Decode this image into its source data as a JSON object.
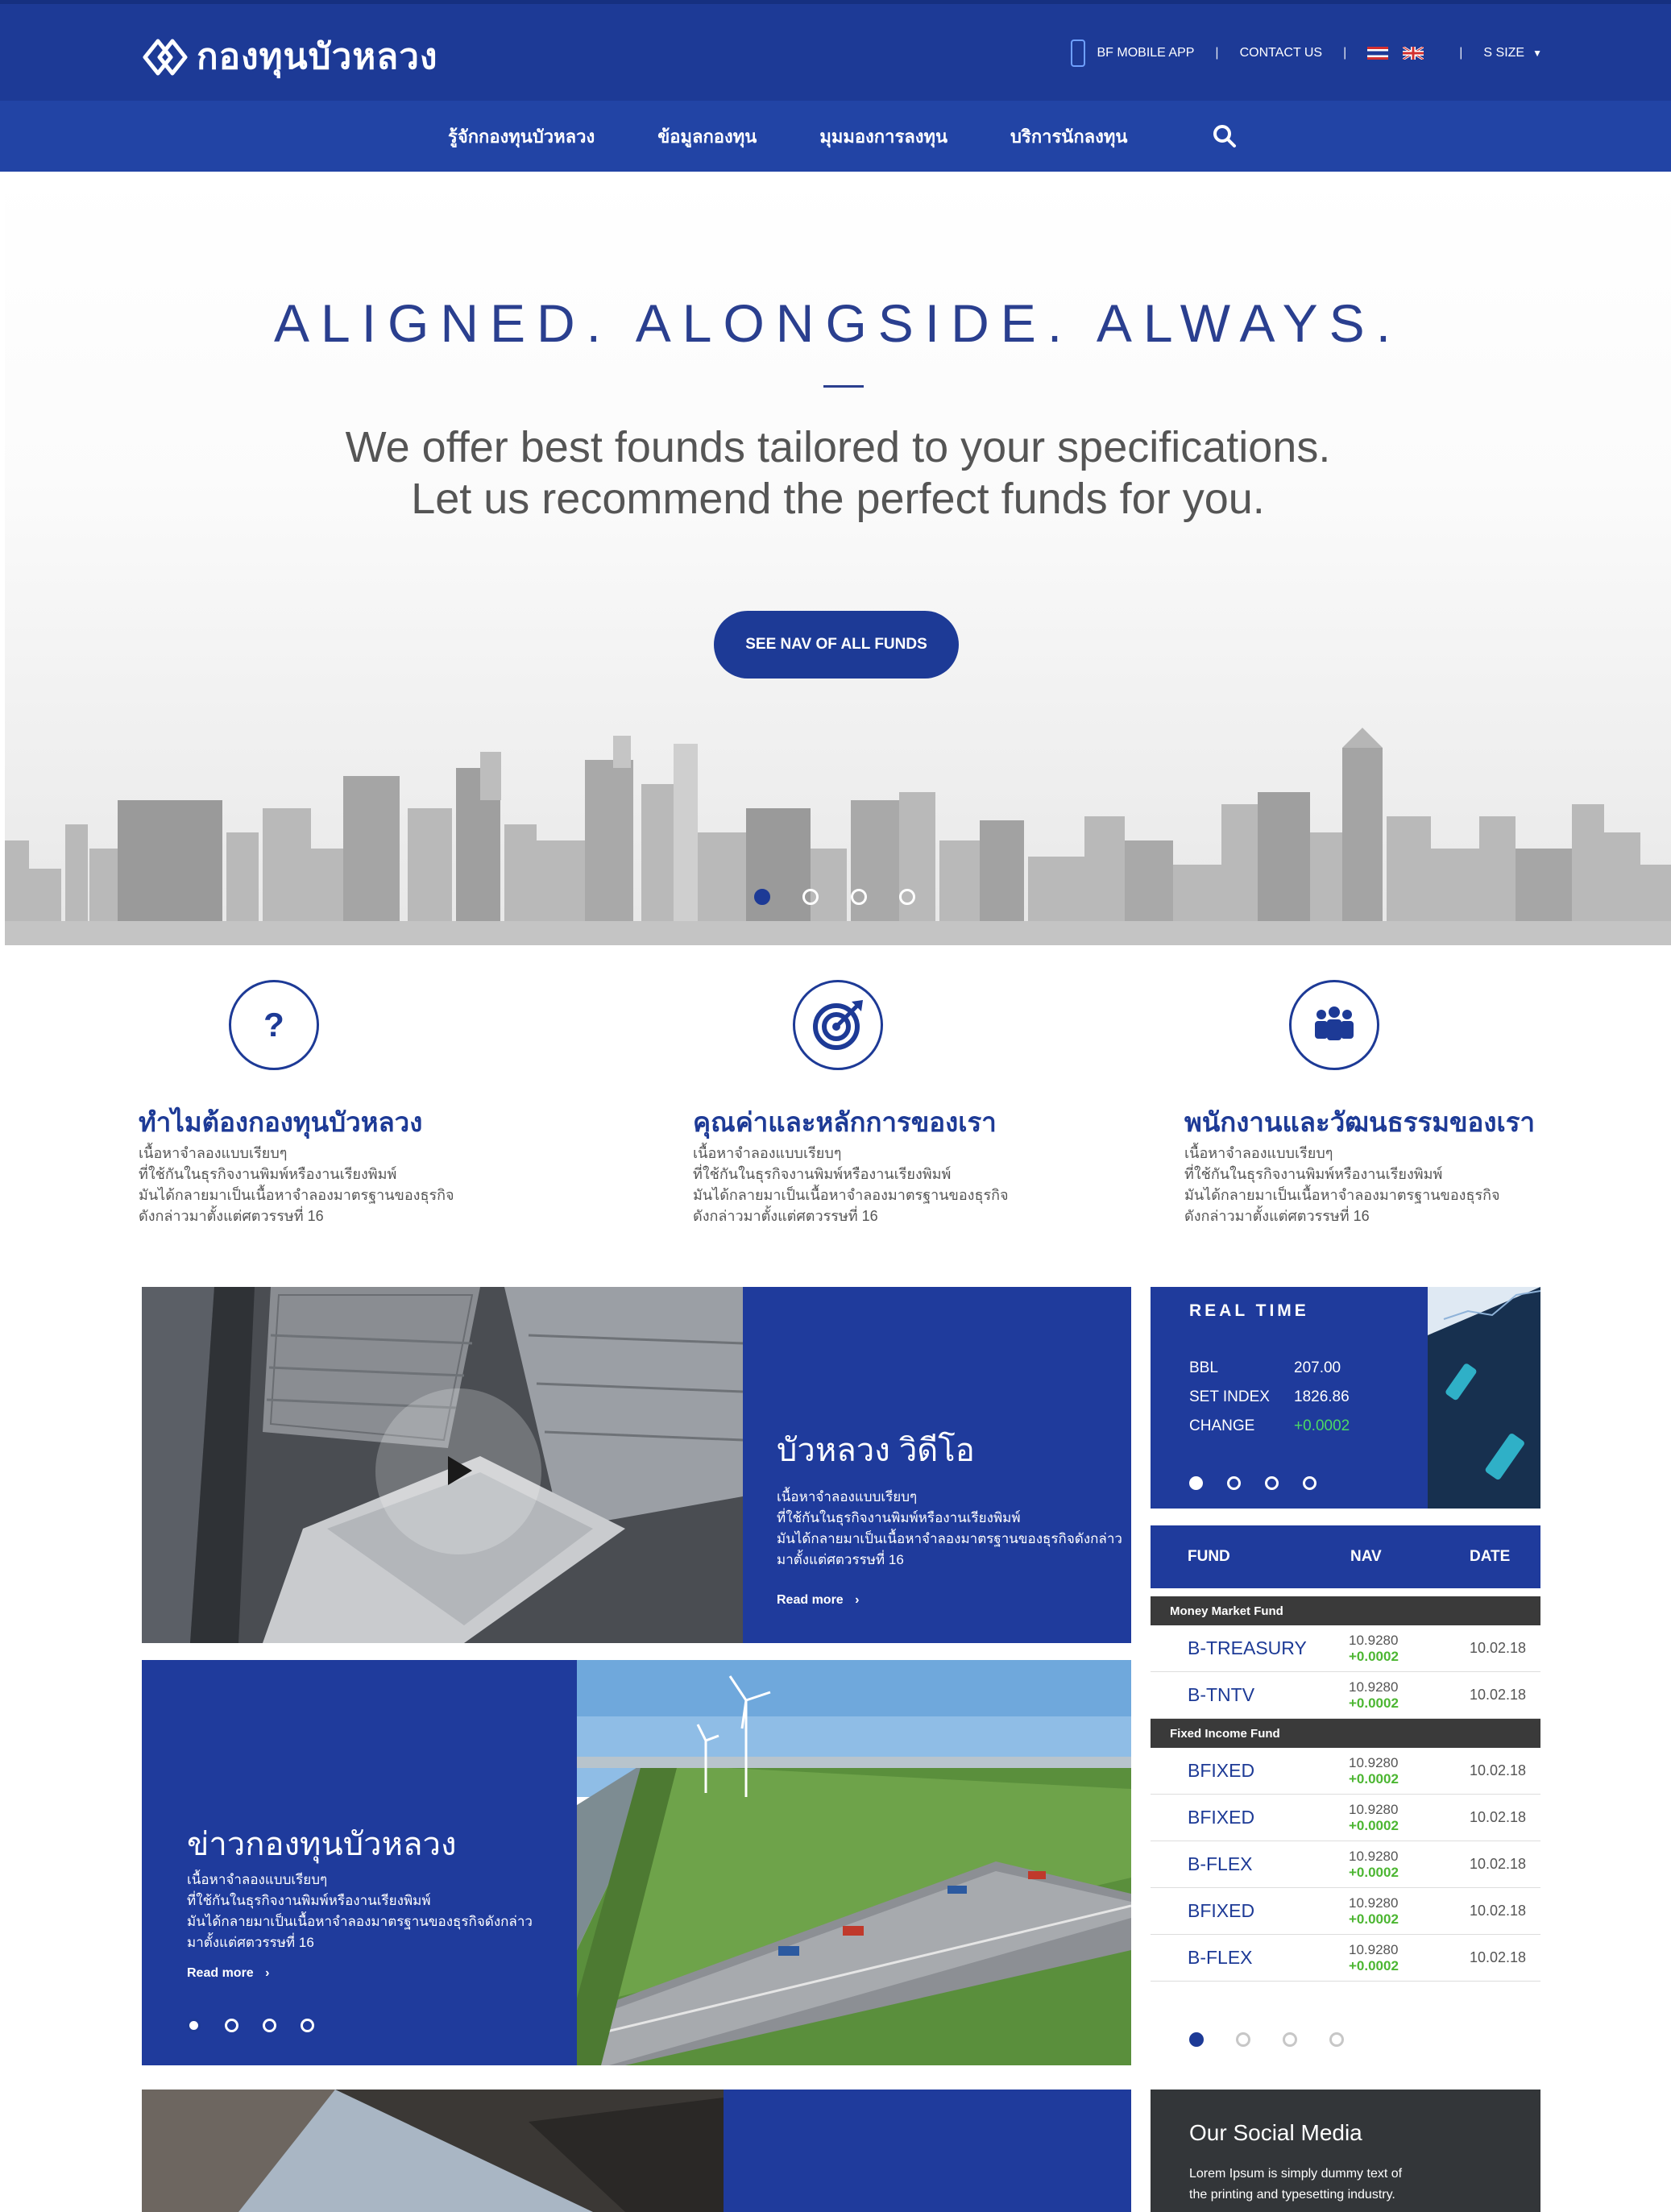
{
  "header": {
    "logo_text": "กองทุนบัวหลวง",
    "mobile_app": "BF MOBILE APP",
    "contact": "CONTACT US",
    "size_label": "S SIZE"
  },
  "nav": {
    "items": [
      "รู้จักกองทุนบัวหลวง",
      "ข้อมูลกองทุน",
      "มุมมองการลงทุน",
      "บริการนักลงทุน"
    ]
  },
  "hero": {
    "title": "ALIGNED. ALONGSIDE. ALWAYS.",
    "subtitle_line1": "We offer best founds tailored to your specifications.",
    "subtitle_line2": "Let us recommend the perfect funds for you.",
    "button": "SEE NAV OF ALL FUNDS"
  },
  "features": [
    {
      "icon": "question-icon",
      "glyph": "?",
      "title": "ทำไมต้องกองทุนบัวหลวง",
      "body": [
        "เนื้อหาจำลองแบบเรียบๆ",
        "ที่ใช้กันในธุรกิจงานพิมพ์หรืองานเรียงพิมพ์",
        "มันได้กลายมาเป็นเนื้อหาจำลองมาตรฐานของธุรกิจ",
        "ดังกล่าวมาตั้งแต่ศตวรรษที่ 16"
      ]
    },
    {
      "icon": "target-icon",
      "glyph": "◎",
      "title": "คุณค่าและหลักการของเรา",
      "body": [
        "เนื้อหาจำลองแบบเรียบๆ",
        "ที่ใช้กันในธุรกิจงานพิมพ์หรืองานเรียงพิมพ์",
        "มันได้กลายมาเป็นเนื้อหาจำลองมาตรฐานของธุรกิจ",
        "ดังกล่าวมาตั้งแต่ศตวรรษที่ 16"
      ]
    },
    {
      "icon": "team-icon",
      "glyph": "👥",
      "title": "พนักงานและวัฒนธรรมของเรา",
      "body": [
        "เนื้อหาจำลองแบบเรียบๆ",
        "ที่ใช้กันในธุรกิจงานพิมพ์หรืองานเรียงพิมพ์",
        "มันได้กลายมาเป็นเนื้อหาจำลองมาตรฐานของธุรกิจ",
        "ดังกล่าวมาตั้งแต่ศตวรรษที่ 16"
      ]
    }
  ],
  "video_card": {
    "title": "บัวหลวง วิดีโอ",
    "body": [
      "เนื้อหาจำลองแบบเรียบๆ",
      "ที่ใช้กันในธุรกิจงานพิมพ์หรืองานเรียงพิมพ์",
      "มันได้กลายมาเป็นเนื้อหาจำลองมาตรฐานของธุรกิจดังกล่าว",
      "มาตั้งแต่ศตวรรษที่ 16"
    ],
    "read_more": "Read more"
  },
  "news_card": {
    "title": "ข่าวกองทุนบัวหลวง",
    "body": [
      "เนื้อหาจำลองแบบเรียบๆ",
      "ที่ใช้กันในธุรกิจงานพิมพ์หรืองานเรียงพิมพ์",
      "มันได้กลายมาเป็นเนื้อหาจำลองมาตรฐานของธุรกิจดังกล่าว",
      "มาตั้งแต่ศตวรรษที่ 16"
    ],
    "read_more": "Read more"
  },
  "realtime": {
    "title": "REAL TIME",
    "rows": [
      {
        "label": "BBL",
        "value": "207.00"
      },
      {
        "label": "SET INDEX",
        "value": "1826.86"
      },
      {
        "label": "CHANGE",
        "value": "+0.0002"
      }
    ]
  },
  "fund_table": {
    "headers": [
      "FUND",
      "NAV",
      "DATE"
    ],
    "groups": [
      {
        "name": "Money Market Fund",
        "rows": [
          {
            "fund": "B-TREASURY",
            "nav": "10.9280",
            "change": "+0.0002",
            "date": "10.02.18"
          },
          {
            "fund": "B-TNTV",
            "nav": "10.9280",
            "change": "+0.0002",
            "date": "10.02.18"
          }
        ]
      },
      {
        "name": "Fixed Income Fund",
        "rows": [
          {
            "fund": "BFIXED",
            "nav": "10.9280",
            "change": "+0.0002",
            "date": "10.02.18"
          },
          {
            "fund": "BFIXED",
            "nav": "10.9280",
            "change": "+0.0002",
            "date": "10.02.18"
          },
          {
            "fund": "B-FLEX",
            "nav": "10.9280",
            "change": "+0.0002",
            "date": "10.02.18"
          },
          {
            "fund": "BFIXED",
            "nav": "10.9280",
            "change": "+0.0002",
            "date": "10.02.18"
          },
          {
            "fund": "B-FLEX",
            "nav": "10.9280",
            "change": "+0.0002",
            "date": "10.02.18"
          }
        ]
      }
    ]
  },
  "social": {
    "title": "Our Social Media",
    "body_line1": "Lorem Ipsum is simply dummy text of",
    "body_line2": "the printing and typesetting industry."
  },
  "colors": {
    "brand": "#1d3a96",
    "blue_card": "#1f3b9c",
    "positive": "#4cb632",
    "dark": "#333639"
  }
}
